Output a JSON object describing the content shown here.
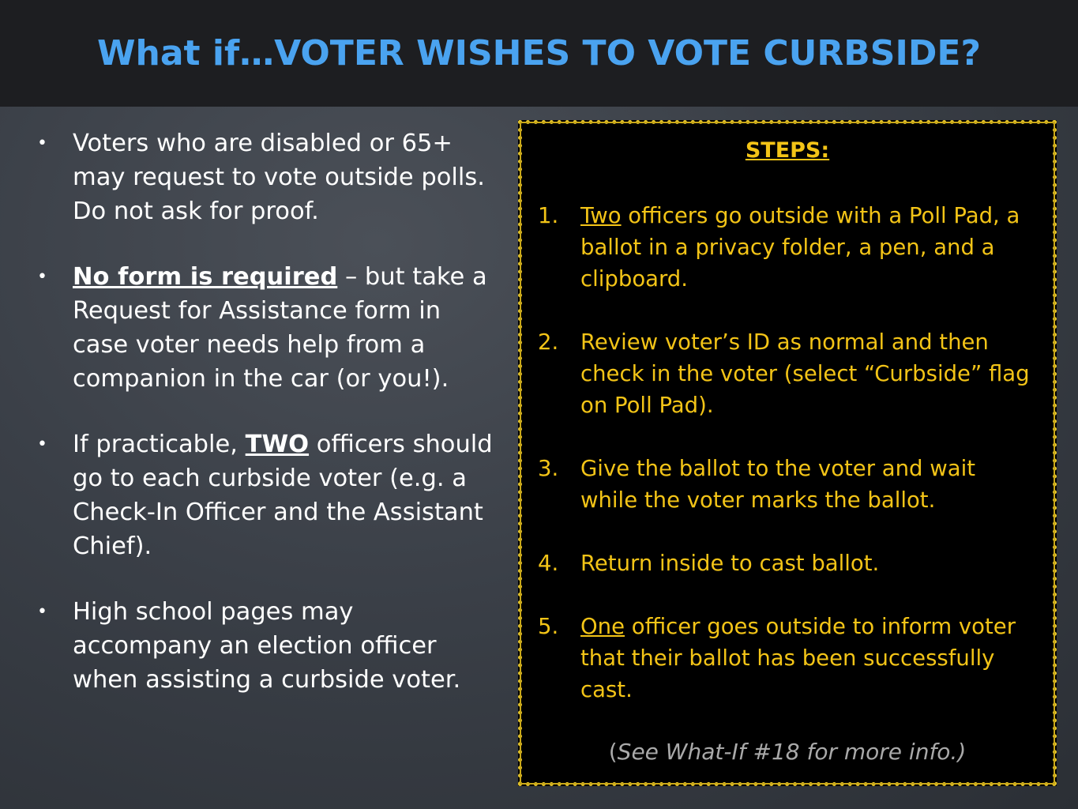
{
  "title": "What if…VOTER WISHES TO VOTE CURBSIDE?",
  "colors": {
    "title": "#4aa3f0",
    "steps_text": "#f3c417",
    "box_border": "#e7c62a",
    "note_text": "#a9a9a9"
  },
  "bullets": [
    {
      "pre": "",
      "emph": "",
      "post": "Voters who are disabled or 65+ may request to vote outside polls. Do not ask for proof."
    },
    {
      "pre": "",
      "emph": "No form is required",
      "post": " – but take a Request for Assistance form in case voter needs help from a companion in the car (or you!)."
    },
    {
      "pre": "If practicable, ",
      "emph": "TWO",
      "post": " officers should go to each curbside voter (e.g. a Check-In Officer and the Assistant Chief)."
    },
    {
      "pre": "",
      "emph": "",
      "post": "High school pages may accompany an election officer when assisting a curbside voter."
    }
  ],
  "bullet_marker": "•",
  "steps": {
    "heading": "STEPS:",
    "items": [
      {
        "num": "1.",
        "emph": "Two",
        "text": " officers go outside with a Poll Pad, a ballot in a privacy folder, a pen, and a clipboard."
      },
      {
        "num": "2.",
        "emph": "",
        "text": "Review voter’s ID as normal and then check in the voter (select “Curbside” flag on Poll Pad)."
      },
      {
        "num": "3.",
        "emph": "",
        "text": "Give the ballot to the voter and wait while the voter marks the ballot."
      },
      {
        "num": "4.",
        "emph": "",
        "text": "Return inside to cast ballot."
      },
      {
        "num": "5.",
        "emph": "One",
        "text": " officer goes outside to inform voter that their ballot has been successfully cast."
      }
    ],
    "note_open": "(",
    "note_body": "See What-If #18 for more info.)"
  }
}
